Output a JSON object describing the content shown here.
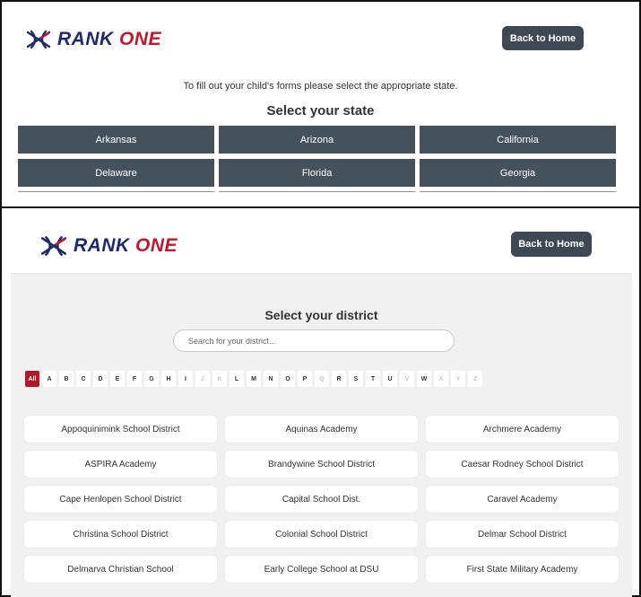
{
  "brand": {
    "name_part1": "RANK",
    "name_part2": "ONE",
    "logo_icon": "rank-one-emblem-icon",
    "primary_color": "#1f2a6b",
    "accent_color": "#c0182a"
  },
  "state_page": {
    "back_button": "Back to Home",
    "instruction": "To fill out your child's forms please select the appropriate state.",
    "heading": "Select your state",
    "states": [
      "Arkansas",
      "Arizona",
      "California",
      "Delaware",
      "Florida",
      "Georgia"
    ],
    "button_color": "#45525c"
  },
  "district_page": {
    "back_button": "Back to Home",
    "heading": "Select your district",
    "search": {
      "placeholder": "Search for your district...",
      "value": ""
    },
    "letters": [
      {
        "label": "All",
        "state": "active"
      },
      {
        "label": "A",
        "state": "enabled"
      },
      {
        "label": "B",
        "state": "enabled"
      },
      {
        "label": "C",
        "state": "enabled"
      },
      {
        "label": "D",
        "state": "enabled"
      },
      {
        "label": "E",
        "state": "enabled"
      },
      {
        "label": "F",
        "state": "enabled"
      },
      {
        "label": "G",
        "state": "enabled"
      },
      {
        "label": "H",
        "state": "enabled"
      },
      {
        "label": "I",
        "state": "enabled"
      },
      {
        "label": "J",
        "state": "disabled"
      },
      {
        "label": "K",
        "state": "disabled"
      },
      {
        "label": "L",
        "state": "enabled"
      },
      {
        "label": "M",
        "state": "enabled"
      },
      {
        "label": "N",
        "state": "enabled"
      },
      {
        "label": "O",
        "state": "enabled"
      },
      {
        "label": "P",
        "state": "enabled"
      },
      {
        "label": "Q",
        "state": "disabled"
      },
      {
        "label": "R",
        "state": "enabled"
      },
      {
        "label": "S",
        "state": "enabled"
      },
      {
        "label": "T",
        "state": "enabled"
      },
      {
        "label": "U",
        "state": "enabled"
      },
      {
        "label": "V",
        "state": "disabled"
      },
      {
        "label": "W",
        "state": "enabled"
      },
      {
        "label": "X",
        "state": "disabled"
      },
      {
        "label": "Y",
        "state": "disabled"
      },
      {
        "label": "Z",
        "state": "disabled"
      }
    ],
    "active_letter_color": "#b3162b",
    "districts": [
      "Appoquinimink School District",
      "Aquinas Academy",
      "Archmere Academy",
      "ASPIRA Academy",
      "Brandywine School District",
      "Caesar Rodney School District",
      "Cape Henlopen School District",
      "Capital School Dist.",
      "Caravel Academy",
      "Christina School District",
      "Colonial School District",
      "Delmar School District",
      "Delmarva Christian School",
      "Early College School at DSU",
      "First State Military Academy"
    ]
  }
}
